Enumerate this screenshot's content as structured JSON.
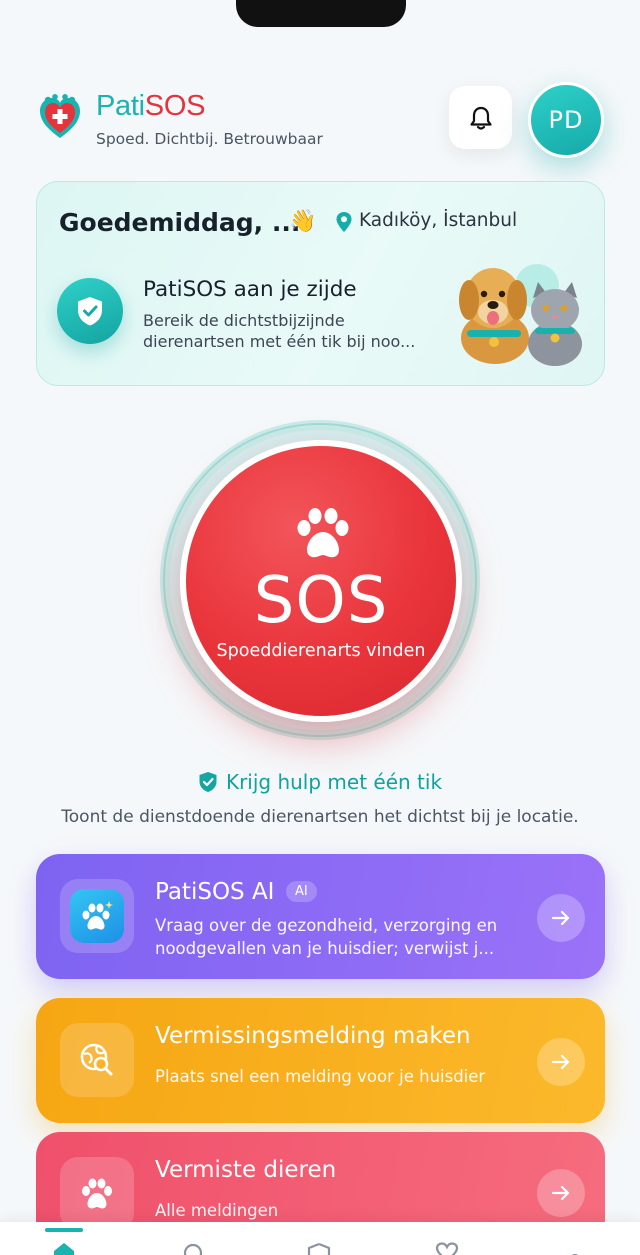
{
  "header": {
    "brand_pati": "Pati",
    "brand_sos": "SOS",
    "tagline": "Spoed. Dichtbij. Betrouwbaar",
    "avatar_initials": "PD",
    "bell_icon": "bell-icon"
  },
  "greeting": {
    "title": "Goedemiddag, ...",
    "emoji": "👋",
    "location": "Kadıköy, İstanbul",
    "side_title": "PatiSOS aan je zijde",
    "side_desc": "Bereik de dichtstbijzijnde dierenartsen met één tik bij noo..."
  },
  "sos": {
    "label": "SOS",
    "sub": "Spoeddierenarts vinden",
    "help_title": "Krijg hulp met één tik",
    "help_desc": "Toont de dienstdoende dierenartsen het dichtst bij je locatie."
  },
  "actions": [
    {
      "title": "PatiSOS AI",
      "badge": "AI",
      "desc": "Vraag over de gezondheid, verzorging en noodgevallen van je huisdier; verwijst j..."
    },
    {
      "title": "Vermissingsmelding maken",
      "desc": "Plaats snel een melding voor je huisdier"
    },
    {
      "title": "Vermiste dieren",
      "desc": "Alle meldingen"
    }
  ],
  "colors": {
    "brand_teal": "#19b3b0",
    "brand_red": "#e5343c",
    "ai_purple": "#7e63f2",
    "report_orange": "#f6a613",
    "lost_pink": "#f0506b"
  }
}
